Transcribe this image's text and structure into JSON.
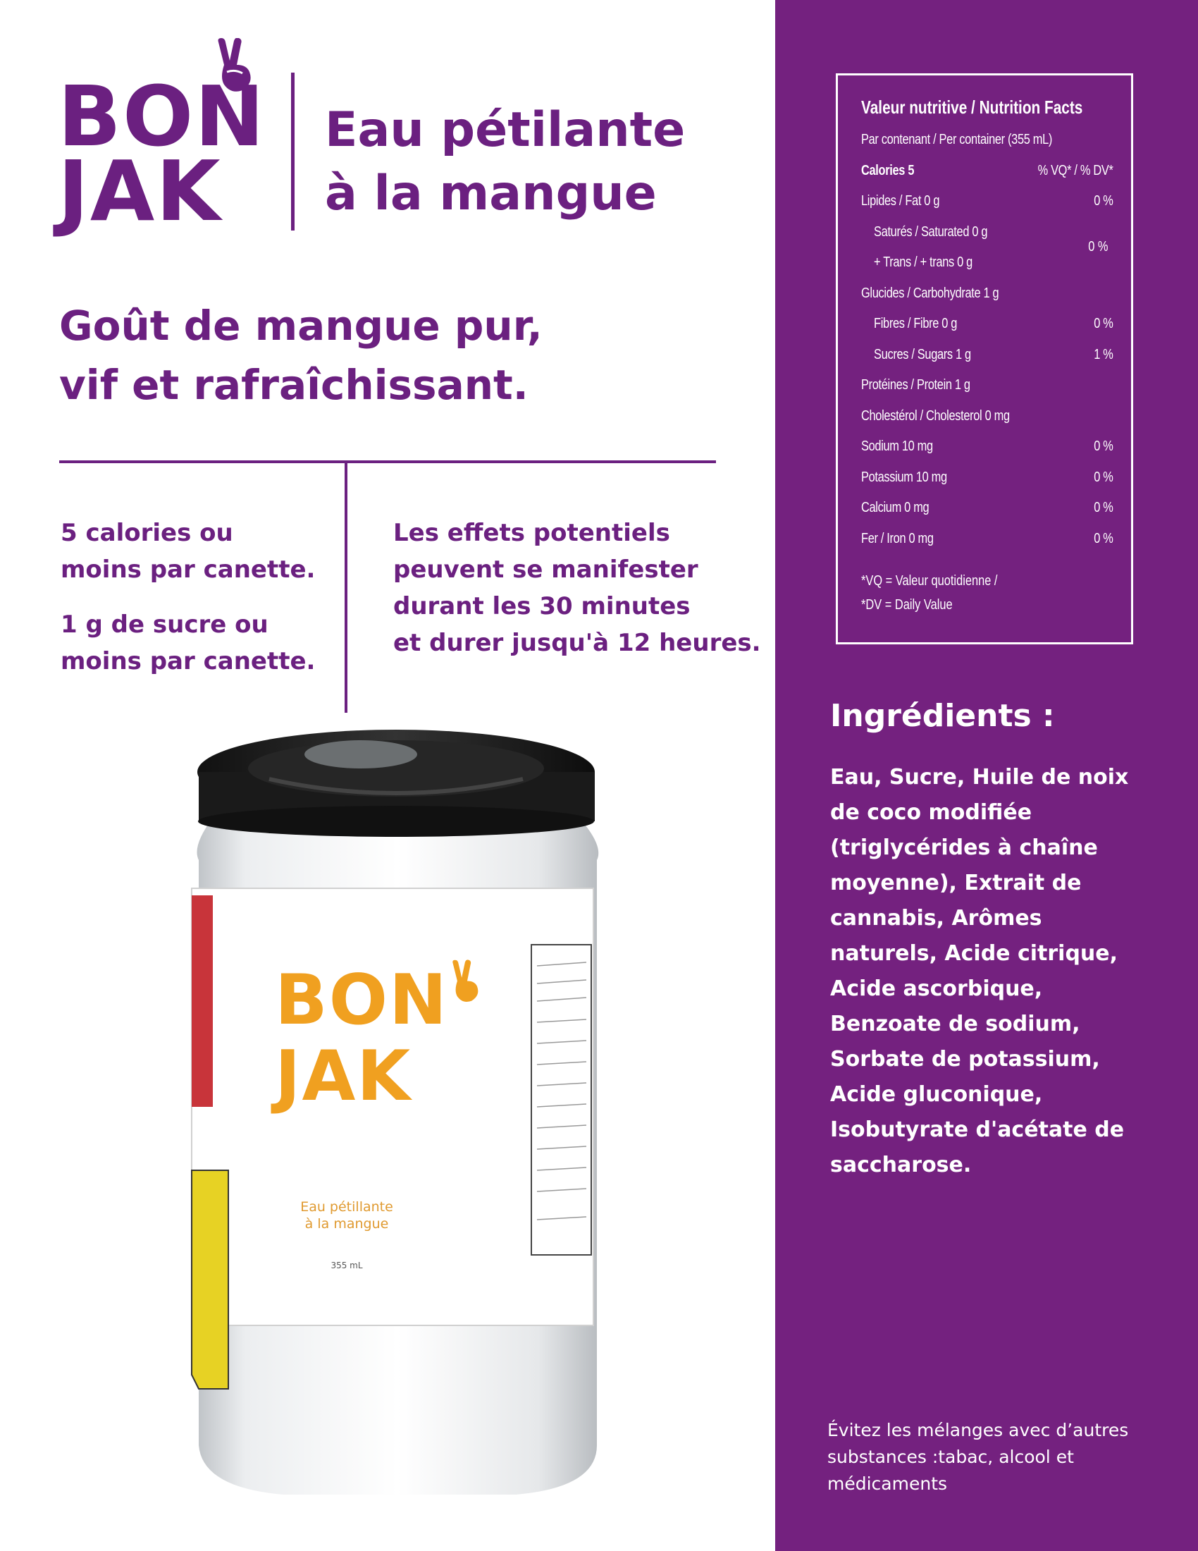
{
  "brand": {
    "logo_line1": "BON",
    "logo_line2": "JAK",
    "color": "#6b2080",
    "icon": "peace-hand-icon"
  },
  "product": {
    "title_line1": "Eau pétilante",
    "title_line2": "à la mangue"
  },
  "tagline": {
    "line1": "Goût de mangue pur,",
    "line2": "vif et rafraîchissant."
  },
  "claims": {
    "calories": [
      "5 calories ou",
      "moins par canette."
    ],
    "sugar": [
      "1 g de sucre ou",
      "moins par canette."
    ],
    "effects": [
      "Les effets potentiels",
      "peuvent se manifester",
      "durant les 30 minutes",
      "et durer jusqu'à 12 heures."
    ]
  },
  "nutrition": {
    "title": "Valeur nutritive / Nutrition Facts",
    "per_container": "Par contenant / Per container (355 mL)",
    "calories_label": "Calories 5",
    "dv_header": "% VQ* / % DV*",
    "rows": [
      {
        "label": "Lipides / Fat 0 g",
        "value": "0 %"
      },
      {
        "label": "Saturés / Saturated 0 g",
        "value": ""
      },
      {
        "label": "+ Trans / + trans 0 g",
        "value": ""
      },
      {
        "label": "Glucides / Carbohydrate 1 g",
        "value": ""
      },
      {
        "label": "Fibres / Fibre 0 g",
        "value": "0 %"
      },
      {
        "label": "Sucres / Sugars 1 g",
        "value": "1 %"
      },
      {
        "label": "Protéines / Protein 1 g",
        "value": ""
      },
      {
        "label": "Cholestérol / Cholesterol 0 mg",
        "value": ""
      },
      {
        "label": "Sodium 10 mg",
        "value": "0 %"
      },
      {
        "label": "Potassium 10 mg",
        "value": "0 %"
      },
      {
        "label": "Calcium 0 mg",
        "value": "0 %"
      },
      {
        "label": "Fer / Iron 0 mg",
        "value": "0 %"
      }
    ],
    "saturated_trans_value": "0 %",
    "footnote_line1": "*VQ = Valeur quotidienne /",
    "footnote_line2": "*DV = Daily Value"
  },
  "ingredients": {
    "title": "Ingrédients :",
    "lines": [
      "Eau, Sucre, Huile de noix",
      "de coco modifiée",
      "(triglycérides à chaîne",
      "moyenne), Extrait de",
      "cannabis, Arômes",
      "naturels, Acide citrique,",
      "Acide ascorbique,",
      "Benzoate de sodium,",
      "Sorbate de potassium,",
      "Acide gluconique,",
      "Isobutyrate d'acétate de",
      "saccharose."
    ]
  },
  "warning": {
    "lines": [
      "Évitez les mélanges avec d’autres",
      "substances :tabac, alcool et",
      "médicaments"
    ]
  },
  "can": {
    "logo_line1": "BON",
    "logo_line2": "JAK",
    "name_line1": "Eau pétillante",
    "name_line2": "à la mangue",
    "volume": "355 mL",
    "accent": "#f0a020"
  },
  "colors": {
    "panel": "#74217f",
    "text": "#6b2080"
  }
}
